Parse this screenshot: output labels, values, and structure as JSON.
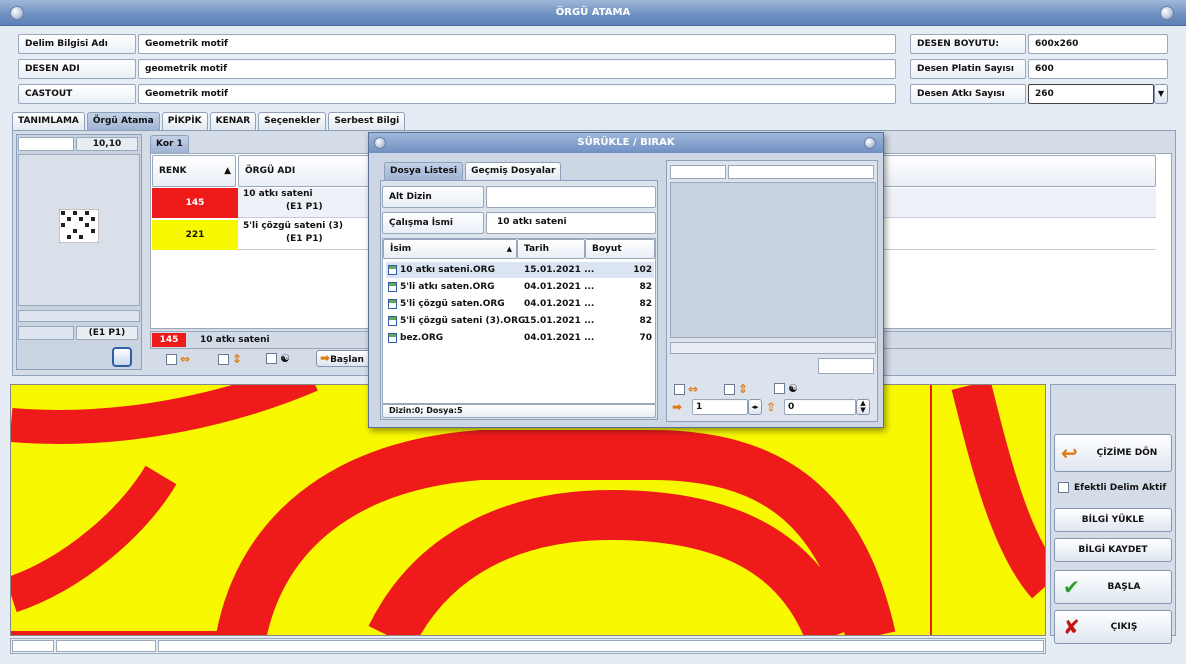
{
  "window": {
    "title": "ÖRGÜ ATAMA"
  },
  "info_left": [
    {
      "label": "Delim Bilgisi Adı",
      "value": "Geometrik motif"
    },
    {
      "label": "DESEN ADI",
      "value": "geometrik motif"
    },
    {
      "label": "CASTOUT",
      "value": "Geometrik motif"
    }
  ],
  "info_right": [
    {
      "label": "DESEN BOYUTU:",
      "value": "600x260"
    },
    {
      "label": "Desen Platin Sayısı",
      "value": "600"
    },
    {
      "label": "Desen Atkı Sayısı",
      "value": "260"
    }
  ],
  "tabs": [
    "TANIMLAMA",
    "Örgü Atama",
    "PİKPİK",
    "KENAR",
    "Seçenekler",
    "Serbest Bilgi"
  ],
  "left_panel": {
    "coord": "10,10",
    "pos": "(E1 P1)"
  },
  "kor_tab": "Kor 1",
  "table": {
    "col_renk": "RENK",
    "col_orgu": "ÖRGÜ ADI",
    "rows": [
      {
        "num": "145",
        "color": "#ef1a1a",
        "name": "10 atkı sateni",
        "pos": "(E1 P1)"
      },
      {
        "num": "221",
        "color": "#f8f800",
        "name": "5'li çözgü sateni (3)",
        "pos": "(E1 P1)"
      }
    ],
    "selected_num": "145",
    "selected_name": "10 atkı sateni"
  },
  "bottom_start": "Başlan",
  "dialog": {
    "title": "SÜRÜKLE / BIRAK",
    "tabs": [
      "Dosya Listesi",
      "Geçmiş Dosyalar"
    ],
    "alt_dizin_label": "Alt Dizin",
    "alt_dizin_value": "",
    "calisma_label": "Çalışma İsmi",
    "calisma_value": "10 atkı sateni",
    "col_isim": "İsim",
    "col_tarih": "Tarih",
    "col_boyut": "Boyut",
    "files": [
      {
        "name": "10 atkı sateni.ORG",
        "date": "15.01.2021 ...",
        "size": "102"
      },
      {
        "name": "5'li atkı saten.ORG",
        "date": "04.01.2021 ...",
        "size": "82"
      },
      {
        "name": "5'li çözgü saten.ORG",
        "date": "04.01.2021 ...",
        "size": "82"
      },
      {
        "name": "5'li çözgü sateni (3).ORG",
        "date": "15.01.2021 ...",
        "size": "82"
      },
      {
        "name": "bez.ORG",
        "date": "04.01.2021 ...",
        "size": "70"
      }
    ],
    "status": "Dizin:0; Dosya:5",
    "stepper1": "1",
    "stepper2": "0"
  },
  "side_buttons": {
    "cizime_don": "ÇİZİME DÖN",
    "efektli": "Efektli Delim Aktif",
    "bilgi_yukle": "BİLGİ YÜKLE",
    "bilgi_kaydet": "BİLGİ KAYDET",
    "basla": "BAŞLA",
    "cikis": "ÇIKIŞ"
  },
  "colors": {
    "red": "#ef1a1a",
    "yellow": "#f8f800",
    "accent": "#6f90c2"
  }
}
